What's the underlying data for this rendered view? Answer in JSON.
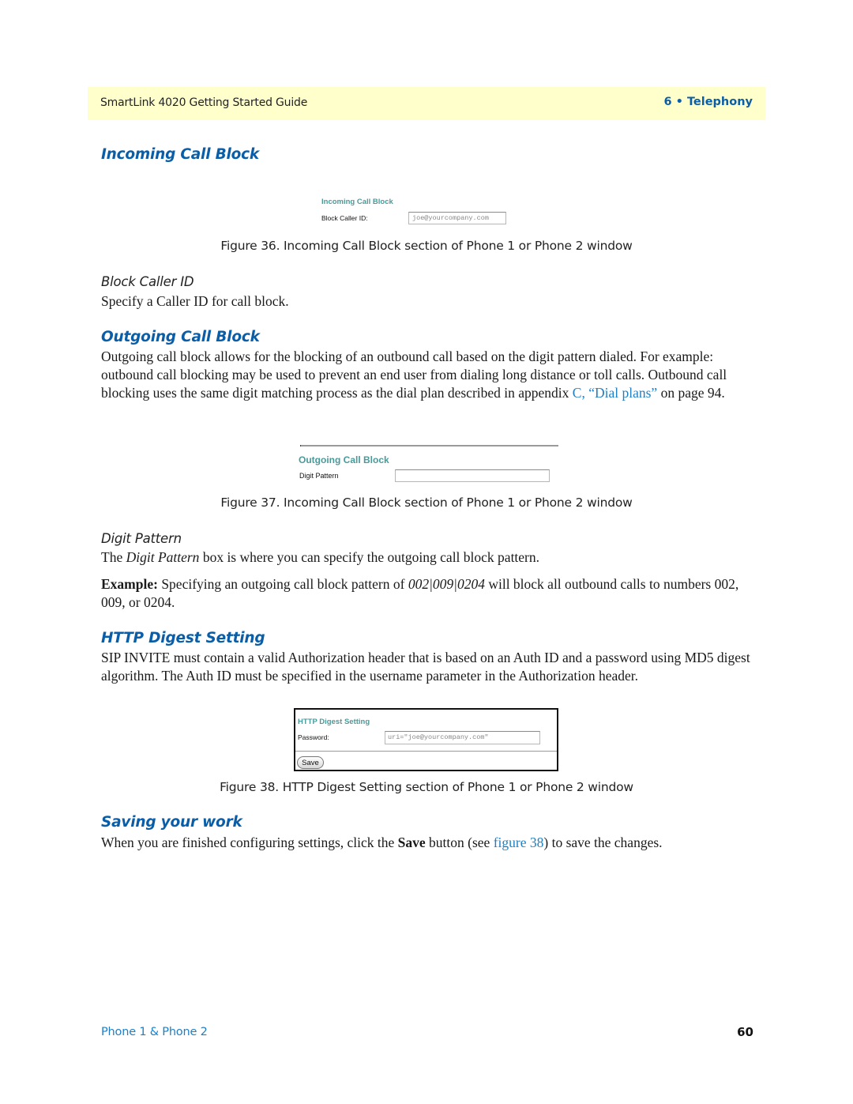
{
  "header": {
    "guide_title": "SmartLink 4020 Getting Started Guide",
    "chapter": "6 • Telephony"
  },
  "sections": {
    "incoming": {
      "heading": "Incoming Call Block",
      "figure": {
        "title": "Incoming Call Block",
        "label": "Block Caller ID:",
        "input_value": "joe@yourcompany.com",
        "caption": "Figure 36. Incoming Call Block section of Phone 1 or Phone 2 window"
      },
      "subheading": "Block Caller ID",
      "body": "Specify a Caller ID for call block."
    },
    "outgoing": {
      "heading": "Outgoing Call Block",
      "body_part1": "Outgoing call block allows for the blocking of an outbound call based on the digit pattern dialed. For example: outbound call blocking may be used to prevent an end user from dialing long distance or toll calls. Outbound call blocking uses the same digit matching process as the dial plan described in appendix ",
      "body_link": "C, “Dial plans”",
      "body_part2": " on page 94.",
      "figure": {
        "title": "Outgoing Call Block",
        "label": "Digit Pattern",
        "input_value": "",
        "caption": "Figure 37. Incoming Call Block section of Phone 1 or Phone 2 window"
      },
      "subheading": "Digit Pattern",
      "body2_part1": "The ",
      "body2_em": "Digit Pattern",
      "body2_part2": " box is where you can specify the outgoing call block pattern.",
      "example_label": "Example:",
      "example_part1": " Specifying an outgoing call block pattern of ",
      "example_em": "002|009|0204",
      "example_part2": " will block all outbound calls to numbers 002, 009, or 0204."
    },
    "http_digest": {
      "heading": "HTTP Digest Setting",
      "body": "SIP INVITE must contain a valid Authorization header that is based on an Auth ID and a password using MD5 digest algorithm. The Auth ID must be specified in the username parameter in the Authorization header.",
      "figure": {
        "title": "HTTP Digest Setting",
        "label": "Password:",
        "input_value": "uri=\"joe@yourcompany.com\"",
        "save_label": "Save",
        "caption": "Figure 38. HTTP Digest Setting section of Phone 1 or Phone 2 window"
      }
    },
    "saving": {
      "heading": "Saving your work",
      "body_part1": "When you are finished configuring settings, click the ",
      "body_bold": "Save",
      "body_part2": " button (see ",
      "body_link": "figure 38",
      "body_part3": ") to save the changes."
    }
  },
  "footer": {
    "section_name": "Phone 1 & Phone 2",
    "page_number": "60"
  }
}
